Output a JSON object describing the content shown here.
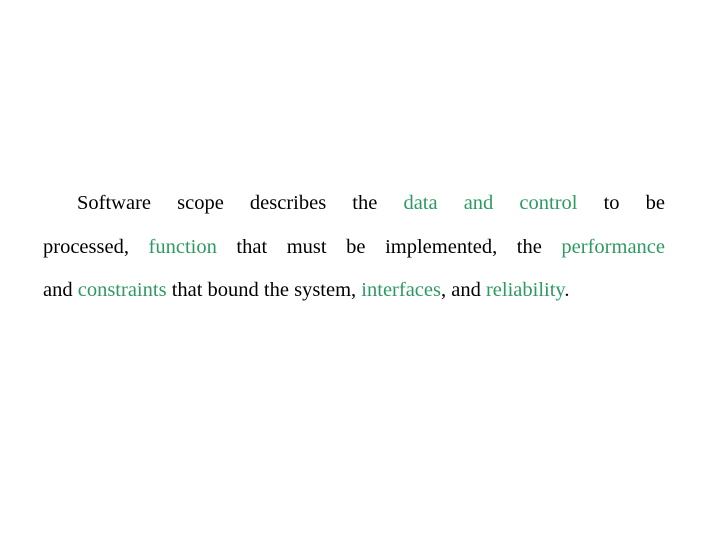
{
  "document": {
    "paragraph": {
      "segments": [
        {
          "text": "Software scope describes the ",
          "highlight": false
        },
        {
          "text": "data and control",
          "highlight": true
        },
        {
          "text": " to be processed, ",
          "highlight": false
        },
        {
          "text": "function",
          "highlight": true
        },
        {
          "text": " that must be implemented, the ",
          "highlight": false
        },
        {
          "text": "performance",
          "highlight": true
        },
        {
          "text": " and ",
          "highlight": false
        },
        {
          "text": "constraints",
          "highlight": true
        },
        {
          "text": " that bound the system, ",
          "highlight": false
        },
        {
          "text": "interfaces",
          "highlight": true
        },
        {
          "text": ", and ",
          "highlight": false
        },
        {
          "text": "reliability",
          "highlight": true
        },
        {
          "text": ".",
          "highlight": false
        }
      ],
      "lines": [
        {
          "parts": [
            {
              "text": "Software scope describes the ",
              "highlight": false
            },
            {
              "text": "data and control",
              "highlight": true
            },
            {
              "text": " to be",
              "highlight": false
            }
          ]
        },
        {
          "parts": [
            {
              "text": "processed, ",
              "highlight": false
            },
            {
              "text": "function",
              "highlight": true
            },
            {
              "text": " that must be implemented, the ",
              "highlight": false
            },
            {
              "text": "performance",
              "highlight": true
            }
          ]
        },
        {
          "parts": [
            {
              "text": "and ",
              "highlight": false
            },
            {
              "text": "constraints",
              "highlight": true
            },
            {
              "text": " that bound the system, ",
              "highlight": false
            },
            {
              "text": "interfaces",
              "highlight": true
            },
            {
              "text": ", and ",
              "highlight": false
            },
            {
              "text": "reliability",
              "highlight": true
            },
            {
              "text": ".",
              "highlight": false
            }
          ]
        }
      ]
    },
    "colors": {
      "text": "#000000",
      "highlight": "#2e9a62",
      "background": "#ffffff"
    }
  }
}
